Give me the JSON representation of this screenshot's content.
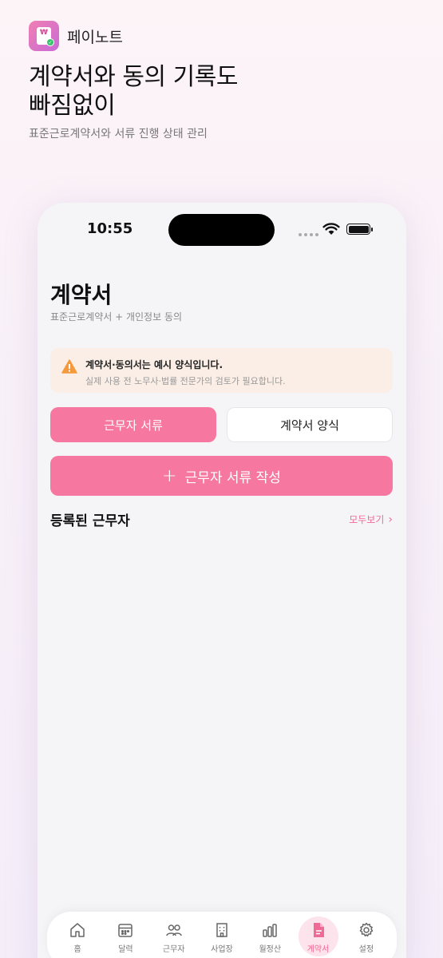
{
  "app": {
    "name": "페이노트",
    "icon_glyph": "₩"
  },
  "hero": {
    "headline_line1": "계약서와 동의 기록도",
    "headline_line2": "빠짐없이",
    "subhead": "표준근로계약서와 서류 진행 상태 관리"
  },
  "status_bar": {
    "time": "10:55"
  },
  "page": {
    "title": "계약서",
    "subtitle": "표준근로계약서 + 개인정보 동의"
  },
  "notice": {
    "title": "계약서·동의서는 예시 양식입니다.",
    "description": "실제 사용 전 노무사·법률 전문가의 검토가 필요합니다."
  },
  "segments": [
    {
      "label": "근무자 서류",
      "active": true
    },
    {
      "label": "계약서 양식",
      "active": false
    }
  ],
  "create_button": {
    "label": "근무자 서류 작성"
  },
  "section": {
    "title": "등록된 근무자",
    "view_all": "모두보기"
  },
  "tabbar": [
    {
      "label": "홈",
      "icon": "home-icon"
    },
    {
      "label": "달력",
      "icon": "calendar-icon"
    },
    {
      "label": "근무자",
      "icon": "users-icon"
    },
    {
      "label": "사업장",
      "icon": "building-icon"
    },
    {
      "label": "월정산",
      "icon": "bar-chart-icon"
    },
    {
      "label": "계약서",
      "icon": "document-icon",
      "active": true
    },
    {
      "label": "설정",
      "icon": "gear-icon"
    }
  ],
  "colors": {
    "accent": "#f6779f",
    "accent_text": "#f06a96",
    "notice_bg": "#faeee6"
  }
}
